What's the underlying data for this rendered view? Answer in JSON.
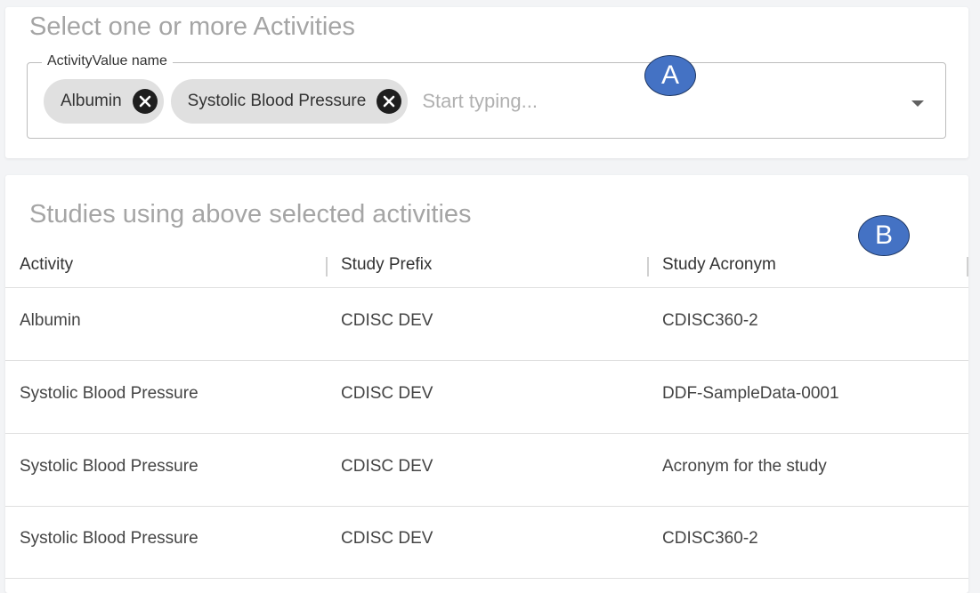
{
  "activity_selector": {
    "title": "Select one or more Activities",
    "field_label": "ActivityValue name",
    "chips": [
      {
        "label": "Albumin"
      },
      {
        "label": "Systolic Blood Pressure"
      }
    ],
    "placeholder": "Start typing..."
  },
  "studies": {
    "title": "Studies using above selected activities",
    "columns": [
      "Activity",
      "Study Prefix",
      "Study Acronym"
    ],
    "rows": [
      [
        "Albumin",
        "CDISC DEV",
        "CDISC360-2"
      ],
      [
        "Systolic Blood Pressure",
        "CDISC DEV",
        "DDF-SampleData-0001"
      ],
      [
        "Systolic Blood Pressure",
        "CDISC DEV",
        "Acronym for the study"
      ],
      [
        "Systolic Blood Pressure",
        "CDISC DEV",
        "CDISC360-2"
      ]
    ]
  },
  "markers": {
    "a": "A",
    "b": "B"
  },
  "colors": {
    "marker_fill": "#4472c4",
    "chip_bg": "#e0e0e0",
    "title_gray": "#a5a5a5"
  }
}
